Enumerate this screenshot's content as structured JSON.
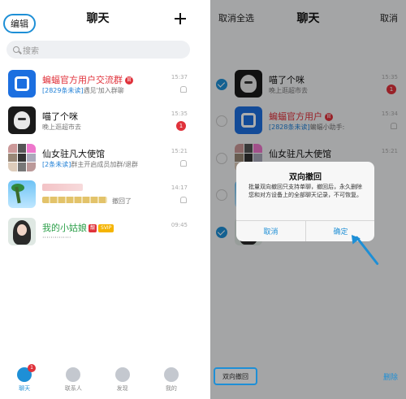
{
  "left": {
    "header": {
      "edit_label": "编辑",
      "title": "聊天"
    },
    "search_placeholder": "搜索",
    "chats": [
      {
        "name": "蝙蝠官方用户交流群",
        "official_tag": "官",
        "preview_highlight": "[2829条未读]",
        "preview": "遇见'加入群聊",
        "time": "15:37"
      },
      {
        "name": "喵了个咪",
        "preview": "晚上逛超市去",
        "time": "15:35",
        "badge": "1"
      },
      {
        "name": "仙女驻凡大使馆",
        "preview_highlight": "[2条未读]",
        "preview": "群主开启成员加群/退群",
        "time": "15:21"
      },
      {
        "preview": "撤回了",
        "time": "14:17"
      },
      {
        "name": "我的小姑娘",
        "vip_tag": "靓",
        "svip_tag": "SVIP",
        "preview": "··············",
        "time": "09:45"
      }
    ],
    "tabbar": {
      "tabs": [
        {
          "label": "聊天",
          "badge": "1"
        },
        {
          "label": "联系人"
        },
        {
          "label": "发现"
        },
        {
          "label": "我的"
        }
      ]
    }
  },
  "right": {
    "header": {
      "select_all": "取消全选",
      "title": "聊天",
      "cancel": "取消"
    },
    "chats": [
      {
        "name": "喵了个咪",
        "preview": "晚上逛超市去",
        "time": "15:35",
        "badge": "1",
        "checked": true
      },
      {
        "name": "蝙蝠官方用户",
        "official_tag": "官",
        "preview_highlight": "[2828条未读]",
        "preview": "蝙蝠小助手:",
        "time": "15:34",
        "checked": false
      },
      {
        "name": "仙女驻凡大使馆",
        "time": "15:21",
        "checked": false
      },
      {
        "checked": false
      },
      {
        "checked": true
      }
    ],
    "dialog": {
      "title": "双向撤回",
      "body": "批量双向撤回只支持单聊，撤回后，永久删除您和对方设备上的全部聊天记录，不可恢复。",
      "cancel": "取消",
      "confirm": "确定"
    },
    "bottom": {
      "recall": "双向撤回",
      "delete": "删除"
    }
  }
}
